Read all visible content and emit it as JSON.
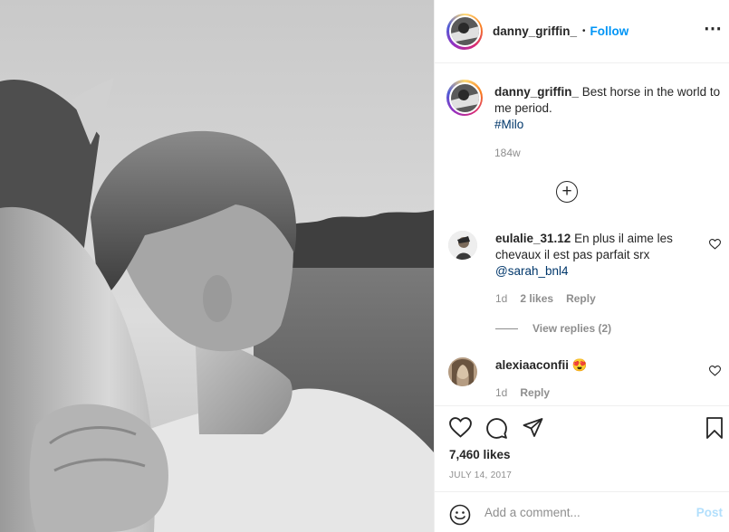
{
  "post": {
    "username": "danny_griffin_",
    "follow_label": "Follow",
    "dot": "•",
    "more_label": "⋯",
    "caption": {
      "username": "danny_griffin_",
      "text": "Best horse in the world to me period.",
      "hashtag": "#Milo",
      "time": "184w"
    },
    "load_more": "+"
  },
  "comments": [
    {
      "username": "eulalie_31.12",
      "text": "En plus il aime les chevaux il est pas parfait srx",
      "mention": "@sarah_bnl4",
      "time": "1d",
      "likes": "2 likes",
      "reply": "Reply",
      "view_replies": "View replies (2)"
    },
    {
      "username": "alexiaaconfii",
      "emoji": "😍",
      "time": "1d",
      "reply": "Reply"
    }
  ],
  "actions": {
    "icons": [
      "heart-icon",
      "comment-icon",
      "share-icon",
      "bookmark-icon"
    ],
    "likes": "7,460 likes",
    "date": "JULY 14, 2017"
  },
  "add_comment": {
    "placeholder": "Add a comment...",
    "post_label": "Post",
    "emoji_icon": "smiley-icon"
  },
  "colors": {
    "link": "#0095f6",
    "hashtag": "#00376b",
    "muted": "#8e8e8e",
    "post_disabled": "#b2dffc"
  }
}
